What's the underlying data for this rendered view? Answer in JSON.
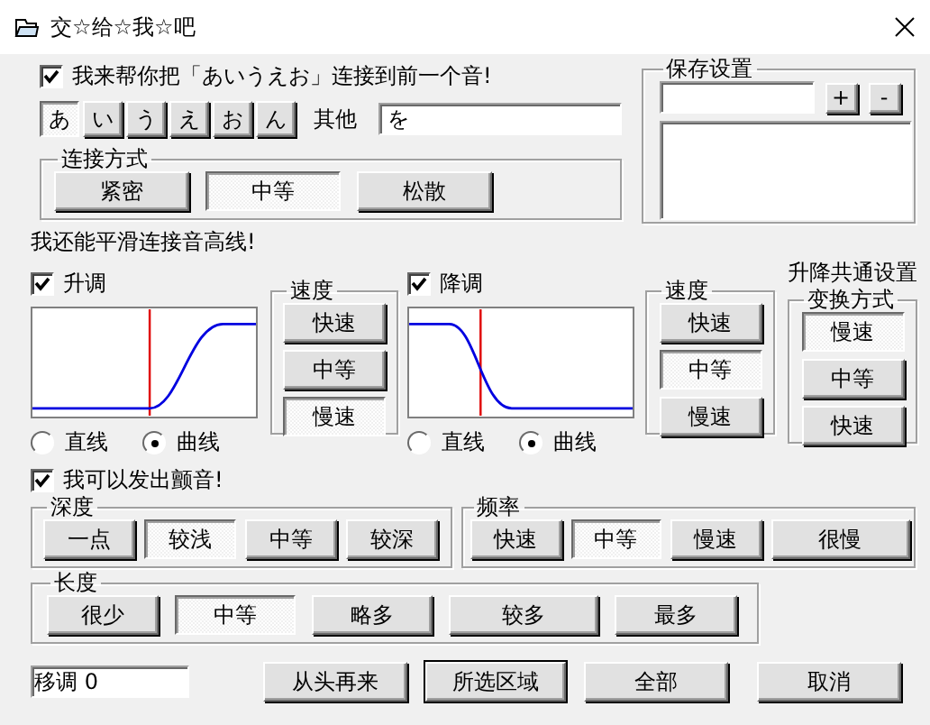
{
  "window": {
    "title": "交☆给☆我☆吧"
  },
  "kana_option": {
    "label": "我来帮你把「あいうえお」连接到前一个音!",
    "checked": true
  },
  "kana_buttons": [
    {
      "label": "あ",
      "selected": true
    },
    {
      "label": "い",
      "selected": false
    },
    {
      "label": "う",
      "selected": false
    },
    {
      "label": "え",
      "selected": false
    },
    {
      "label": "お",
      "selected": false
    },
    {
      "label": "ん",
      "selected": false
    }
  ],
  "other": {
    "label": "其他",
    "value": "を"
  },
  "connection": {
    "title": "连接方式",
    "options": [
      {
        "label": "紧密",
        "selected": false
      },
      {
        "label": "中等",
        "selected": true
      },
      {
        "label": "松散",
        "selected": false
      }
    ]
  },
  "saved_settings": {
    "title": "保存设置",
    "add": "+",
    "remove": "-"
  },
  "pitch": {
    "title": "我还能平滑连接音高线!",
    "rise": {
      "kind": "rise",
      "label": "升调",
      "checked": true,
      "shape": [
        {
          "label": "直线",
          "selected": false
        },
        {
          "label": "曲线",
          "selected": true
        }
      ],
      "speed": {
        "title": "速度",
        "options": [
          {
            "label": "快速",
            "selected": false
          },
          {
            "label": "中等",
            "selected": false
          },
          {
            "label": "慢速",
            "selected": true
          }
        ]
      }
    },
    "fall": {
      "kind": "fall",
      "label": "降调",
      "checked": true,
      "shape": [
        {
          "label": "直线",
          "selected": false
        },
        {
          "label": "曲线",
          "selected": true
        }
      ],
      "speed": {
        "title": "速度",
        "options": [
          {
            "label": "快速",
            "selected": false
          },
          {
            "label": "中等",
            "selected": true
          },
          {
            "label": "慢速",
            "selected": false
          }
        ]
      }
    },
    "common": {
      "caption": "升降共通设置",
      "title": "变换方式",
      "options": [
        {
          "label": "慢速",
          "selected": true
        },
        {
          "label": "中等",
          "selected": false
        },
        {
          "label": "快速",
          "selected": false
        }
      ]
    }
  },
  "vibrato": {
    "label": "我可以发出颤音!",
    "checked": true,
    "depth": {
      "title": "深度",
      "options": [
        {
          "label": "一点",
          "selected": false
        },
        {
          "label": "较浅",
          "selected": true
        },
        {
          "label": "中等",
          "selected": false
        },
        {
          "label": "较深",
          "selected": false
        }
      ]
    },
    "frequency": {
      "title": "频率",
      "options": [
        {
          "label": "快速",
          "selected": false
        },
        {
          "label": "中等",
          "selected": true
        },
        {
          "label": "慢速",
          "selected": false
        },
        {
          "label": "很慢",
          "selected": false
        }
      ]
    },
    "length": {
      "title": "长度",
      "options": [
        {
          "label": "很少",
          "selected": false
        },
        {
          "label": "中等",
          "selected": true
        },
        {
          "label": "略多",
          "selected": false
        },
        {
          "label": "较多",
          "selected": false
        },
        {
          "label": "最多",
          "selected": false
        }
      ]
    }
  },
  "footer": {
    "transpose": "移调 0",
    "buttons": [
      {
        "label": "从头再来",
        "default": false
      },
      {
        "label": "所选区域",
        "default": true
      },
      {
        "label": "全部",
        "default": false
      },
      {
        "label": "取消",
        "default": false
      }
    ]
  }
}
